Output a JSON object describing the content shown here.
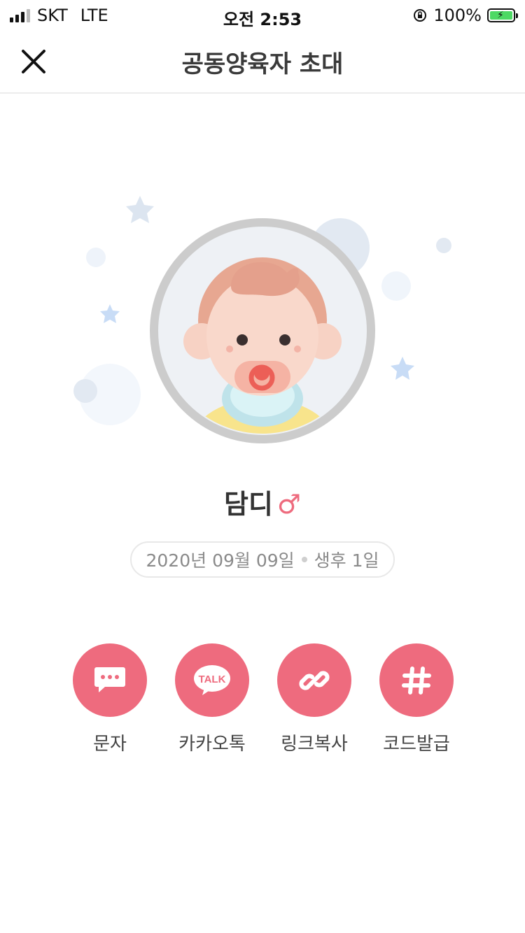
{
  "status_bar": {
    "carrier": "SKT",
    "network": "LTE",
    "time": "오전 2:53",
    "battery_percent": "100%"
  },
  "nav": {
    "title": "공동양육자 초대",
    "close_icon": "close-icon"
  },
  "child": {
    "name": "담디",
    "gender_symbol": "♂",
    "birth_date": "2020년 09월 09일",
    "days_since_birth": "생후 1일"
  },
  "share_options": [
    {
      "label": "문자",
      "icon": "message-icon"
    },
    {
      "label": "카카오톡",
      "icon": "kakaotalk-icon"
    },
    {
      "label": "링크복사",
      "icon": "link-icon"
    },
    {
      "label": "코드발급",
      "icon": "hashtag-icon"
    }
  ],
  "colors": {
    "accent": "#ee6b7e",
    "battery": "#4cd964"
  }
}
